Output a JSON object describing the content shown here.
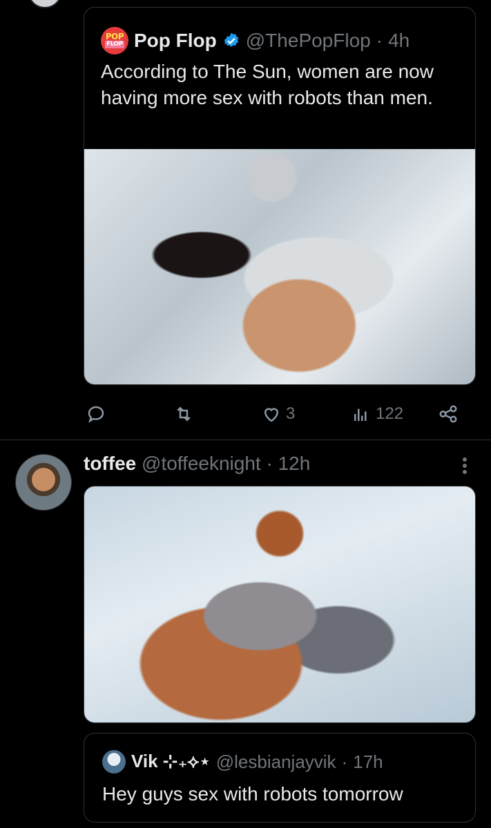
{
  "quoted_tweet": {
    "logo_top": "POP",
    "logo_bottom": "FLOP",
    "display_name": "Pop Flop",
    "handle": "@ThePopFlop",
    "separator": "·",
    "time": "4h",
    "text": "According to The Sun, women are now having more sex with robots than men.",
    "image_icon": "photo"
  },
  "actions": {
    "reply_icon": "reply-icon",
    "retweet_icon": "retweet-icon",
    "like_icon": "heart-icon",
    "like_count": "3",
    "views_icon": "views-icon",
    "views_count": "122",
    "share_icon": "share-icon"
  },
  "reply_tweet": {
    "display_name": "toffee",
    "handle": "@toffeeknight",
    "separator": "·",
    "time": "12h",
    "image_icon": "photo"
  },
  "inner_quote": {
    "display_name": "Vik ⊹₊⟡⋆",
    "handle": "@lesbianjayvik",
    "separator": "·",
    "time": "17h",
    "text": "Hey guys sex with robots tomorrow"
  },
  "colors": {
    "background": "#000000",
    "text": "#e7e9ea",
    "muted": "#71767b",
    "border": "#2f3336",
    "verified": "#1d9bf0"
  }
}
